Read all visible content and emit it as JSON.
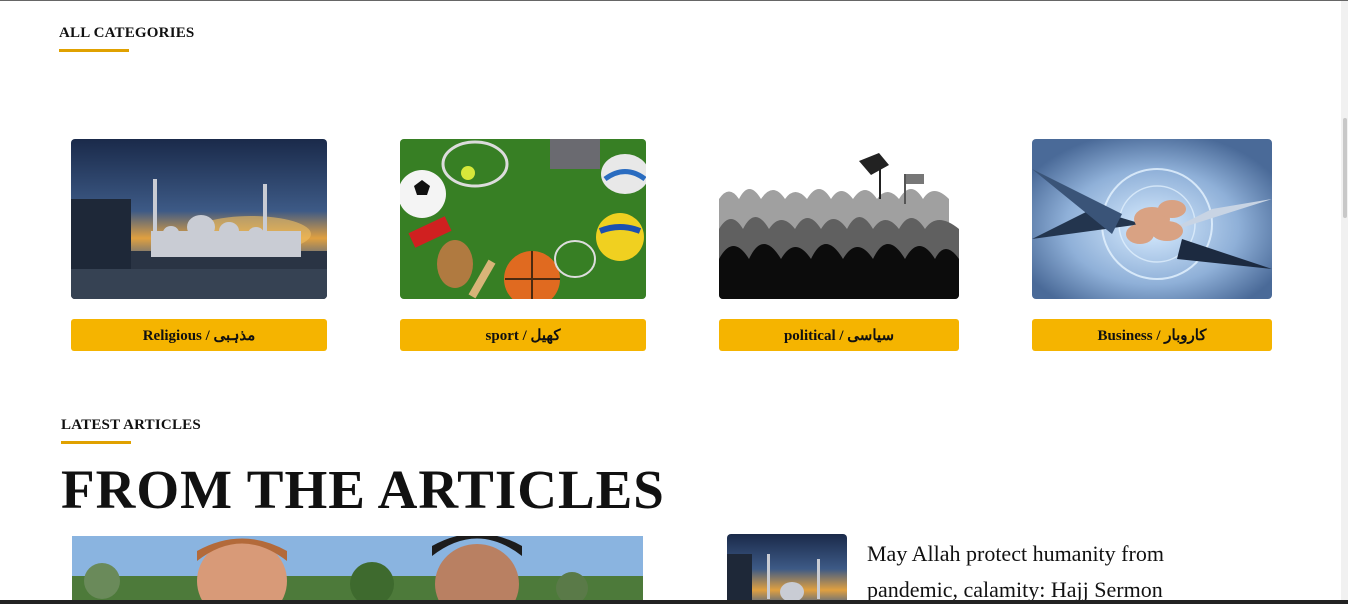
{
  "categories_section": {
    "label": "ALL CATEGORIES",
    "items": [
      {
        "label": "Religious / مذہبی",
        "icon": "mosque-image"
      },
      {
        "label": "sport / کھیل",
        "icon": "sports-equipment-image"
      },
      {
        "label": "political / سیاسی",
        "icon": "crowd-silhouette-image"
      },
      {
        "label": "Business / کاروبار",
        "icon": "hands-together-image"
      }
    ]
  },
  "articles_section": {
    "label": "LATEST ARTICLES",
    "heading": "FROM THE ARTICLES",
    "side_article_title": "May Allah protect humanity from pandemic, calamity: Hajj Sermon"
  },
  "colors": {
    "accent": "#f5b400",
    "underline": "#e0a100",
    "text": "#111111"
  }
}
